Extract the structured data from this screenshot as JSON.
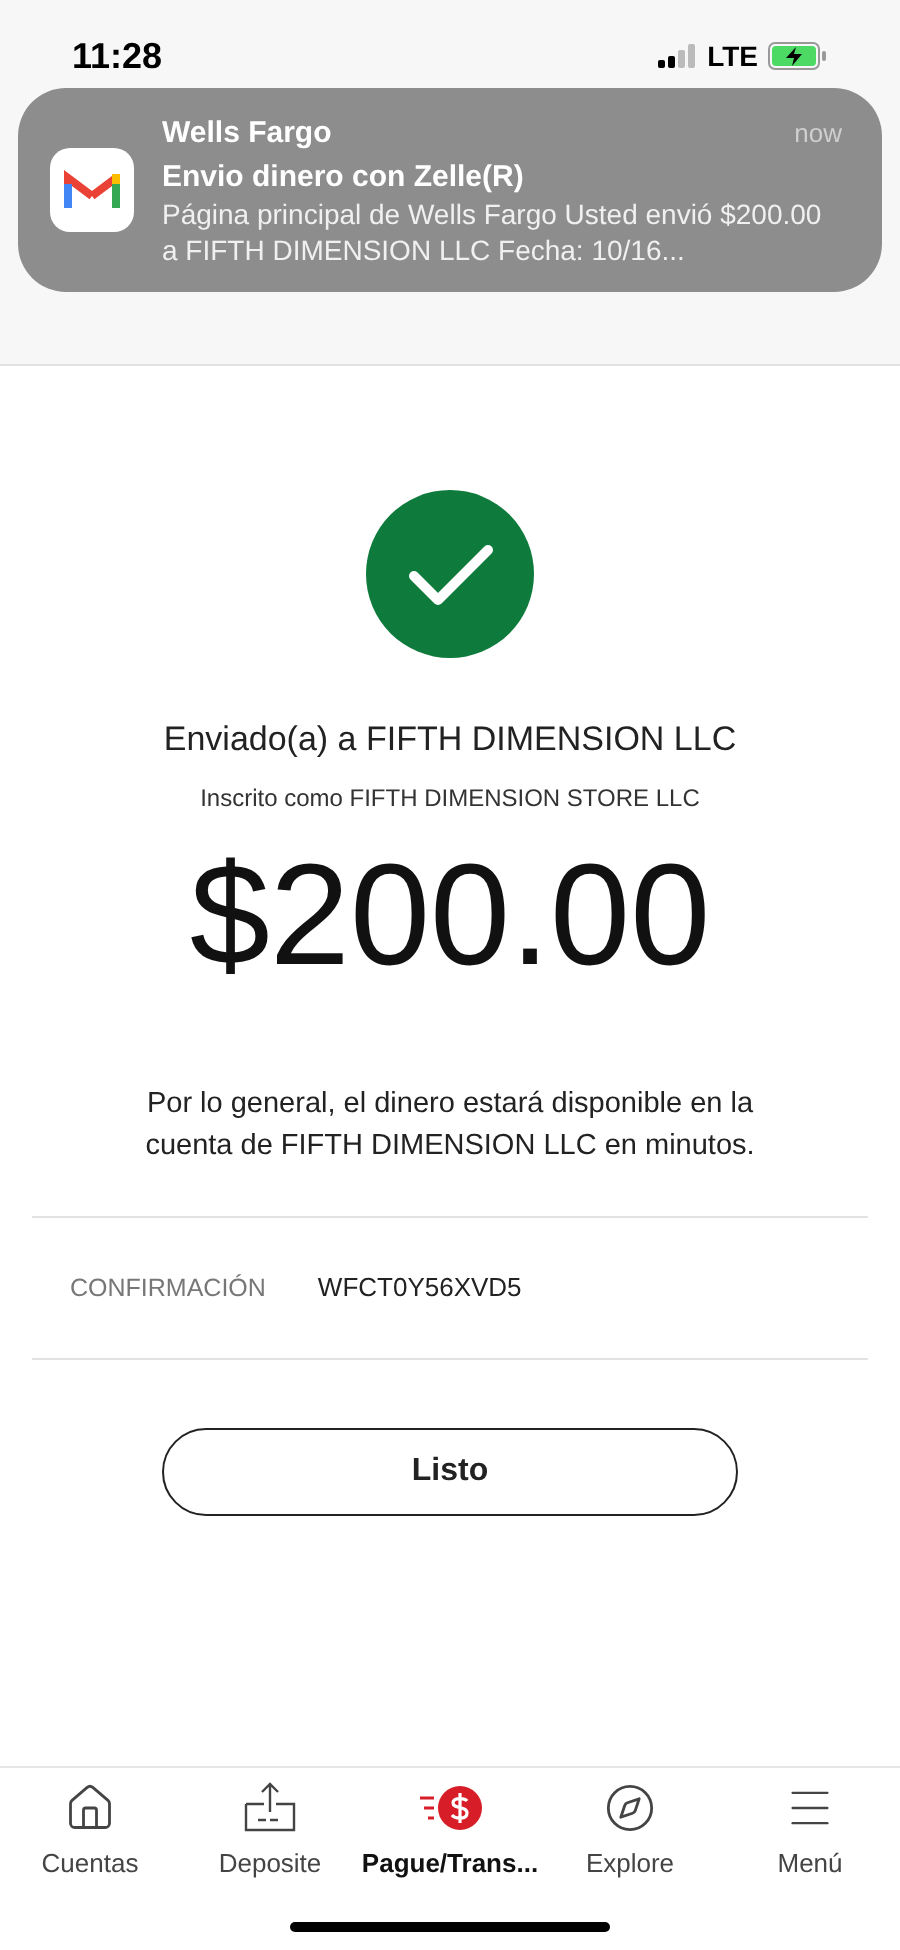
{
  "status_bar": {
    "time": "11:28",
    "network": "LTE"
  },
  "notification": {
    "app": "Wells Fargo",
    "time": "now",
    "title": "Envio dinero con Zelle(R)",
    "body": "Página principal de Wells Fargo Usted envió $200.00 a FIFTH DIMENSION LLC Fecha: 10/16..."
  },
  "confirmation": {
    "recipient": "Enviado(a) a FIFTH DIMENSION LLC",
    "enrolled_as": "Inscrito como FIFTH DIMENSION STORE LLC",
    "amount": "$200.00",
    "message": "Por lo general, el dinero estará disponible en la cuenta de FIFTH DIMENSION LLC en minutos.",
    "confirmation_label": "CONFIRMACIÓN",
    "confirmation_code": "WFCT0Y56XVD5",
    "done_button": "Listo"
  },
  "tab_bar": [
    {
      "kind": "home",
      "label": "Cuentas",
      "selected": false
    },
    {
      "kind": "deposit",
      "label": "Deposite",
      "selected": false
    },
    {
      "kind": "pay",
      "label": "Pague/Trans...",
      "selected": true
    },
    {
      "kind": "explore",
      "label": "Explore",
      "selected": false
    },
    {
      "kind": "menu",
      "label": "Menú",
      "selected": false
    }
  ]
}
